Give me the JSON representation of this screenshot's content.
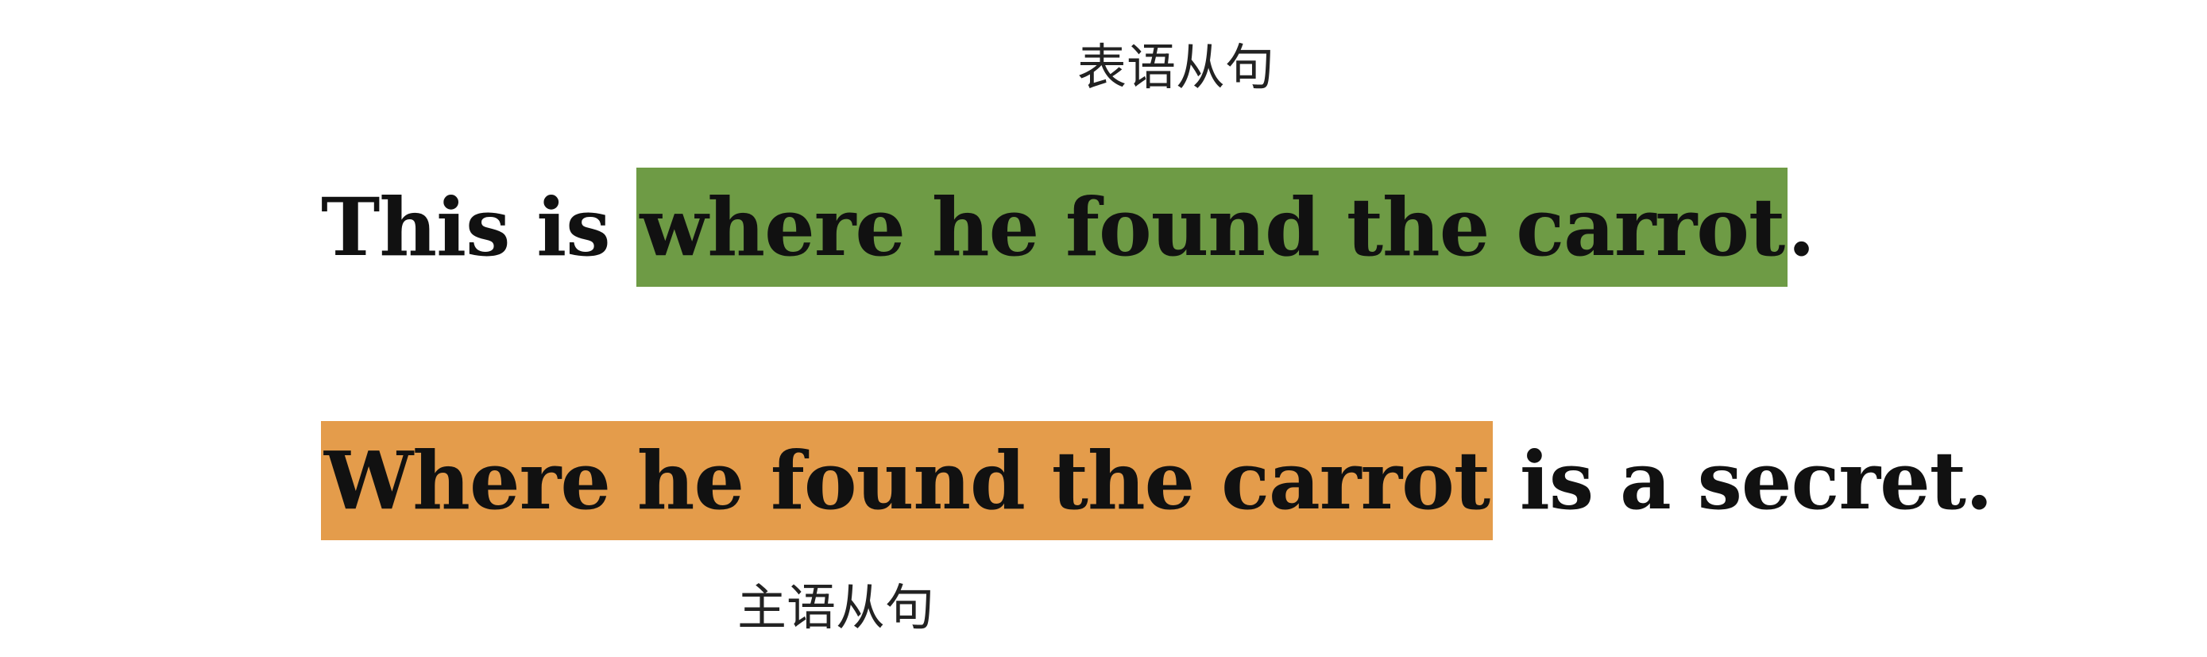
{
  "top_label": "表语从句",
  "bottom_label": "主语从句",
  "sentence1": {
    "prefix": "This is ",
    "highlight": "where he found the carrot",
    "suffix": ".",
    "highlight_color": "#6e9b45"
  },
  "sentence2": {
    "highlight": "Where he found the carrot",
    "suffix": " is a secret.",
    "highlight_color": "#e49c4b"
  }
}
